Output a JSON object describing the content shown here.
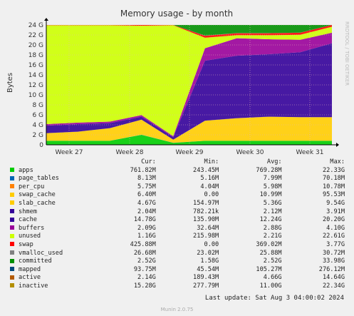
{
  "chart_data": {
    "type": "area",
    "title": "Memory usage - by month",
    "ylabel": "Bytes",
    "watermark": "RRDTOOL / TOBI OETIKER",
    "y_ticks": [
      "0",
      "2 G",
      "4 G",
      "6 G",
      "8 G",
      "10 G",
      "12 G",
      "14 G",
      "16 G",
      "18 G",
      "20 G",
      "22 G",
      "24 G"
    ],
    "ylim": [
      0,
      24
    ],
    "x_ticks": [
      "Week 27",
      "Week 28",
      "Week 29",
      "Week 30",
      "Week 31"
    ],
    "grid": true,
    "header": {
      "cur": "Cur:",
      "min": "Min:",
      "avg": "Avg:",
      "max": "Max:"
    },
    "series": [
      {
        "name": "apps",
        "color": "#00cc00",
        "cur": "761.82M",
        "min": "243.45M",
        "avg": "769.28M",
        "max": "22.33G",
        "values": [
          0.8,
          0.8,
          0.8,
          2.0,
          0.4,
          0.8,
          0.8,
          0.8,
          0.8,
          0.8
        ]
      },
      {
        "name": "page_tables",
        "color": "#0066b3",
        "cur": "8.13M",
        "min": "5.16M",
        "avg": "7.99M",
        "max": "70.18M",
        "values": [
          0.01,
          0.01,
          0.01,
          0.01,
          0.01,
          0.01,
          0.01,
          0.01,
          0.01,
          0.01
        ]
      },
      {
        "name": "per_cpu",
        "color": "#ff8000",
        "cur": "5.75M",
        "min": "4.04M",
        "avg": "5.98M",
        "max": "10.78M",
        "values": [
          0.01,
          0.01,
          0.01,
          0.01,
          0.01,
          0.01,
          0.01,
          0.01,
          0.01,
          0.01
        ]
      },
      {
        "name": "swap_cache",
        "color": "#ffcc00",
        "cur": "6.40M",
        "min": "0.00",
        "avg": "10.99M",
        "max": "95.53M",
        "values": [
          0.01,
          0.01,
          0.01,
          0.01,
          0.01,
          0.01,
          0.01,
          0.01,
          0.01,
          0.01
        ]
      },
      {
        "name": "slab_cache",
        "color": "#ffcc00",
        "cur": "4.67G",
        "min": "154.97M",
        "avg": "5.36G",
        "max": "9.54G",
        "values": [
          1.5,
          1.8,
          2.5,
          3.0,
          0.6,
          4.0,
          4.5,
          4.8,
          4.7,
          4.7
        ]
      },
      {
        "name": "shmem",
        "color": "#330099",
        "cur": "2.04M",
        "min": "782.21k",
        "avg": "2.12M",
        "max": "3.91M",
        "values": [
          0.01,
          0.01,
          0.01,
          0.01,
          0.01,
          0.01,
          0.01,
          0.01,
          0.01,
          0.01
        ]
      },
      {
        "name": "cache",
        "color": "#330099",
        "cur": "14.78G",
        "min": "135.90M",
        "avg": "12.24G",
        "max": "20.20G",
        "values": [
          1.5,
          1.5,
          1.0,
          0.6,
          0.5,
          12.0,
          12.5,
          12.5,
          13.0,
          14.8
        ]
      },
      {
        "name": "buffers",
        "color": "#990099",
        "cur": "2.09G",
        "min": "32.64M",
        "avg": "2.88G",
        "max": "4.10G",
        "values": [
          0.3,
          0.3,
          0.3,
          0.3,
          0.2,
          2.5,
          3.5,
          3.0,
          2.5,
          2.1
        ]
      },
      {
        "name": "unused",
        "color": "#ccff00",
        "cur": "1.16G",
        "min": "215.98M",
        "avg": "2.21G",
        "max": "22.61G",
        "values": [
          19.8,
          19.5,
          19.3,
          17.9,
          22.2,
          2.1,
          0.6,
          0.8,
          1.0,
          1.2
        ]
      },
      {
        "name": "swap",
        "color": "#ff0000",
        "cur": "425.88M",
        "min": "0.00",
        "avg": "369.02M",
        "max": "3.77G",
        "values": [
          0.1,
          0.1,
          0.1,
          0.2,
          0.1,
          0.4,
          0.4,
          0.4,
          0.4,
          0.4
        ]
      },
      {
        "name": "vmalloc_used",
        "color": "#808080",
        "cur": "26.68M",
        "min": "23.02M",
        "avg": "25.88M",
        "max": "30.72M",
        "values": [
          0.03,
          0.03,
          0.03,
          0.03,
          0.03,
          0.03,
          0.03,
          0.03,
          0.03,
          0.03
        ]
      },
      {
        "name": "committed",
        "color": "#008f00",
        "cur": "2.52G",
        "min": "1.58G",
        "avg": "2.52G",
        "max": "33.98G",
        "values": [
          2.5,
          2.5,
          2.5,
          2.5,
          2.3,
          2.5,
          2.5,
          2.5,
          2.5,
          2.5
        ]
      },
      {
        "name": "mapped",
        "color": "#00487d",
        "cur": "93.75M",
        "min": "45.54M",
        "avg": "105.27M",
        "max": "276.12M",
        "values": [
          0.1,
          0.1,
          0.1,
          0.1,
          0.1,
          0.1,
          0.1,
          0.1,
          0.1,
          0.1
        ]
      },
      {
        "name": "active",
        "color": "#b35a00",
        "cur": "2.14G",
        "min": "189.43M",
        "avg": "4.66G",
        "max": "14.64G",
        "values": [
          4.0,
          5.5,
          3.0,
          2.0,
          1.5,
          4.5,
          5.0,
          5.5,
          4.5,
          2.1
        ]
      },
      {
        "name": "inactive",
        "color": "#b38f00",
        "cur": "15.28G",
        "min": "277.79M",
        "avg": "11.00G",
        "max": "22.34G",
        "values": [
          5.0,
          8.0,
          10.0,
          11.0,
          2.0,
          10.0,
          11.0,
          11.5,
          13.0,
          15.3
        ]
      }
    ],
    "last_update": "Last update: Sat Aug  3 04:00:02 2024",
    "generator": "Munin 2.0.75"
  }
}
